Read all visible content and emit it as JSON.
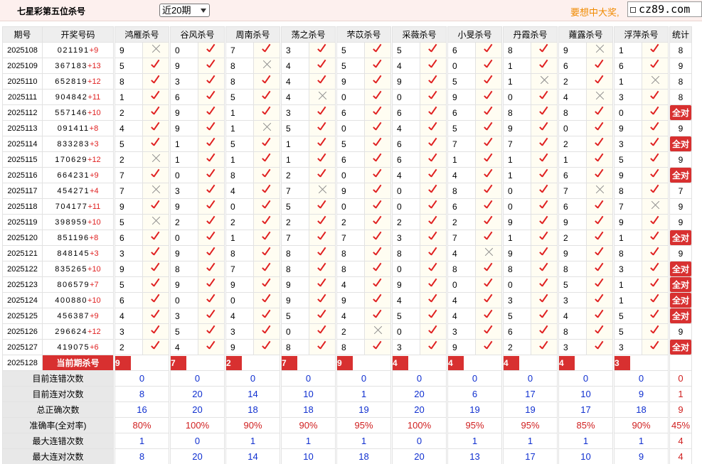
{
  "header": {
    "title": "七星彩第五位杀号",
    "period_select": "近20期",
    "promo": "要想中大奖,",
    "site": "cz89.com"
  },
  "columns": {
    "issue": "期号",
    "numbers": "开奖号码",
    "experts": [
      "鸿雁杀号",
      "谷风杀号",
      "周南杀号",
      "荡之杀号",
      "芣苡杀号",
      "采薇杀号",
      "小旻杀号",
      "丹霞杀号",
      "蕹露杀号",
      "浮萍杀号"
    ],
    "stat": "统计"
  },
  "draws": [
    {
      "issue": "2025108",
      "digits": "021191",
      "add": "+9",
      "kills": [
        [
          9,
          false
        ],
        [
          0,
          true
        ],
        [
          7,
          true
        ],
        [
          3,
          true
        ],
        [
          5,
          true
        ],
        [
          5,
          true
        ],
        [
          6,
          true
        ],
        [
          8,
          true
        ],
        [
          9,
          false
        ],
        [
          1,
          true
        ]
      ],
      "stat": "8"
    },
    {
      "issue": "2025109",
      "digits": "367183",
      "add": "+13",
      "kills": [
        [
          5,
          true
        ],
        [
          9,
          true
        ],
        [
          8,
          false
        ],
        [
          4,
          true
        ],
        [
          5,
          true
        ],
        [
          4,
          true
        ],
        [
          0,
          true
        ],
        [
          1,
          true
        ],
        [
          6,
          true
        ],
        [
          6,
          true
        ]
      ],
      "stat": "9"
    },
    {
      "issue": "2025110",
      "digits": "652819",
      "add": "+12",
      "kills": [
        [
          8,
          true
        ],
        [
          3,
          true
        ],
        [
          8,
          true
        ],
        [
          4,
          true
        ],
        [
          9,
          true
        ],
        [
          9,
          true
        ],
        [
          5,
          true
        ],
        [
          1,
          false
        ],
        [
          2,
          true
        ],
        [
          1,
          false
        ]
      ],
      "stat": "8"
    },
    {
      "issue": "2025111",
      "digits": "904842",
      "add": "+11",
      "kills": [
        [
          1,
          true
        ],
        [
          6,
          true
        ],
        [
          5,
          true
        ],
        [
          4,
          false
        ],
        [
          0,
          true
        ],
        [
          0,
          true
        ],
        [
          9,
          true
        ],
        [
          0,
          true
        ],
        [
          4,
          false
        ],
        [
          3,
          true
        ]
      ],
      "stat": "8"
    },
    {
      "issue": "2025112",
      "digits": "557146",
      "add": "+10",
      "kills": [
        [
          2,
          true
        ],
        [
          9,
          true
        ],
        [
          1,
          true
        ],
        [
          3,
          true
        ],
        [
          6,
          true
        ],
        [
          6,
          true
        ],
        [
          6,
          true
        ],
        [
          8,
          true
        ],
        [
          8,
          true
        ],
        [
          0,
          true
        ]
      ],
      "stat": "全对"
    },
    {
      "issue": "2025113",
      "digits": "091411",
      "add": "+8",
      "kills": [
        [
          4,
          true
        ],
        [
          9,
          true
        ],
        [
          1,
          false
        ],
        [
          5,
          true
        ],
        [
          0,
          true
        ],
        [
          4,
          true
        ],
        [
          5,
          true
        ],
        [
          9,
          true
        ],
        [
          0,
          true
        ],
        [
          9,
          true
        ]
      ],
      "stat": "9"
    },
    {
      "issue": "2025114",
      "digits": "833283",
      "add": "+3",
      "kills": [
        [
          5,
          true
        ],
        [
          1,
          true
        ],
        [
          5,
          true
        ],
        [
          1,
          true
        ],
        [
          5,
          true
        ],
        [
          6,
          true
        ],
        [
          7,
          true
        ],
        [
          7,
          true
        ],
        [
          2,
          true
        ],
        [
          3,
          true
        ]
      ],
      "stat": "全对"
    },
    {
      "issue": "2025115",
      "digits": "170629",
      "add": "+12",
      "kills": [
        [
          2,
          false
        ],
        [
          1,
          true
        ],
        [
          1,
          true
        ],
        [
          1,
          true
        ],
        [
          6,
          true
        ],
        [
          6,
          true
        ],
        [
          1,
          true
        ],
        [
          1,
          true
        ],
        [
          1,
          true
        ],
        [
          5,
          true
        ]
      ],
      "stat": "9"
    },
    {
      "issue": "2025116",
      "digits": "664231",
      "add": "+9",
      "kills": [
        [
          7,
          true
        ],
        [
          0,
          true
        ],
        [
          8,
          true
        ],
        [
          2,
          true
        ],
        [
          0,
          true
        ],
        [
          4,
          true
        ],
        [
          4,
          true
        ],
        [
          1,
          true
        ],
        [
          6,
          true
        ],
        [
          9,
          true
        ]
      ],
      "stat": "全对"
    },
    {
      "issue": "2025117",
      "digits": "454271",
      "add": "+4",
      "kills": [
        [
          7,
          false
        ],
        [
          3,
          true
        ],
        [
          4,
          true
        ],
        [
          7,
          false
        ],
        [
          9,
          true
        ],
        [
          0,
          true
        ],
        [
          8,
          true
        ],
        [
          0,
          true
        ],
        [
          7,
          false
        ],
        [
          8,
          true
        ]
      ],
      "stat": "7"
    },
    {
      "issue": "2025118",
      "digits": "704177",
      "add": "+11",
      "kills": [
        [
          9,
          true
        ],
        [
          9,
          true
        ],
        [
          0,
          true
        ],
        [
          5,
          true
        ],
        [
          0,
          true
        ],
        [
          0,
          true
        ],
        [
          6,
          true
        ],
        [
          0,
          true
        ],
        [
          6,
          true
        ],
        [
          7,
          false
        ]
      ],
      "stat": "9"
    },
    {
      "issue": "2025119",
      "digits": "398959",
      "add": "+10",
      "kills": [
        [
          5,
          false
        ],
        [
          2,
          true
        ],
        [
          2,
          true
        ],
        [
          2,
          true
        ],
        [
          2,
          true
        ],
        [
          2,
          true
        ],
        [
          2,
          true
        ],
        [
          9,
          true
        ],
        [
          9,
          true
        ],
        [
          9,
          true
        ]
      ],
      "stat": "9"
    },
    {
      "issue": "2025120",
      "digits": "851196",
      "add": "+8",
      "kills": [
        [
          6,
          true
        ],
        [
          0,
          true
        ],
        [
          1,
          true
        ],
        [
          7,
          true
        ],
        [
          7,
          true
        ],
        [
          3,
          true
        ],
        [
          7,
          true
        ],
        [
          1,
          true
        ],
        [
          2,
          true
        ],
        [
          1,
          true
        ]
      ],
      "stat": "全对"
    },
    {
      "issue": "2025121",
      "digits": "848145",
      "add": "+3",
      "kills": [
        [
          3,
          true
        ],
        [
          9,
          true
        ],
        [
          8,
          true
        ],
        [
          8,
          true
        ],
        [
          8,
          true
        ],
        [
          8,
          true
        ],
        [
          4,
          false
        ],
        [
          9,
          true
        ],
        [
          9,
          true
        ],
        [
          8,
          true
        ]
      ],
      "stat": "9"
    },
    {
      "issue": "2025122",
      "digits": "835265",
      "add": "+10",
      "kills": [
        [
          9,
          true
        ],
        [
          8,
          true
        ],
        [
          7,
          true
        ],
        [
          8,
          true
        ],
        [
          8,
          true
        ],
        [
          0,
          true
        ],
        [
          8,
          true
        ],
        [
          8,
          true
        ],
        [
          8,
          true
        ],
        [
          3,
          true
        ]
      ],
      "stat": "全对"
    },
    {
      "issue": "2025123",
      "digits": "806579",
      "add": "+7",
      "kills": [
        [
          5,
          true
        ],
        [
          9,
          true
        ],
        [
          9,
          true
        ],
        [
          9,
          true
        ],
        [
          4,
          true
        ],
        [
          9,
          true
        ],
        [
          0,
          true
        ],
        [
          0,
          true
        ],
        [
          5,
          true
        ],
        [
          1,
          true
        ]
      ],
      "stat": "全对"
    },
    {
      "issue": "2025124",
      "digits": "400880",
      "add": "+10",
      "kills": [
        [
          6,
          true
        ],
        [
          0,
          true
        ],
        [
          0,
          true
        ],
        [
          9,
          true
        ],
        [
          9,
          true
        ],
        [
          4,
          true
        ],
        [
          4,
          true
        ],
        [
          3,
          true
        ],
        [
          3,
          true
        ],
        [
          1,
          true
        ]
      ],
      "stat": "全对"
    },
    {
      "issue": "2025125",
      "digits": "456387",
      "add": "+9",
      "kills": [
        [
          4,
          true
        ],
        [
          3,
          true
        ],
        [
          4,
          true
        ],
        [
          5,
          true
        ],
        [
          4,
          true
        ],
        [
          5,
          true
        ],
        [
          4,
          true
        ],
        [
          5,
          true
        ],
        [
          4,
          true
        ],
        [
          5,
          true
        ]
      ],
      "stat": "全对"
    },
    {
      "issue": "2025126",
      "digits": "296624",
      "add": "+12",
      "kills": [
        [
          3,
          true
        ],
        [
          5,
          true
        ],
        [
          3,
          true
        ],
        [
          0,
          true
        ],
        [
          2,
          false
        ],
        [
          0,
          true
        ],
        [
          3,
          true
        ],
        [
          6,
          true
        ],
        [
          8,
          true
        ],
        [
          5,
          true
        ]
      ],
      "stat": "9"
    },
    {
      "issue": "2025127",
      "digits": "419075",
      "add": "+6",
      "kills": [
        [
          2,
          true
        ],
        [
          4,
          true
        ],
        [
          9,
          true
        ],
        [
          8,
          true
        ],
        [
          8,
          true
        ],
        [
          3,
          true
        ],
        [
          9,
          true
        ],
        [
          2,
          true
        ],
        [
          3,
          true
        ],
        [
          3,
          true
        ]
      ],
      "stat": "全对"
    }
  ],
  "current": {
    "issue": "2025128",
    "label": "当前期杀号",
    "kills": [
      "9",
      "7",
      "2",
      "7",
      "9",
      "4",
      "4",
      "4",
      "4",
      "3"
    ]
  },
  "stats": [
    {
      "label": "目前连错次数",
      "values": [
        "0",
        "0",
        "0",
        "0",
        "0",
        "0",
        "0",
        "0",
        "0",
        "0"
      ],
      "total": "0",
      "red": false
    },
    {
      "label": "目前连对次数",
      "values": [
        "8",
        "20",
        "14",
        "10",
        "1",
        "20",
        "6",
        "17",
        "10",
        "9"
      ],
      "total": "1",
      "red": false
    },
    {
      "label": "总正确次数",
      "values": [
        "16",
        "20",
        "18",
        "18",
        "19",
        "20",
        "19",
        "19",
        "17",
        "18"
      ],
      "total": "9",
      "red": false
    },
    {
      "label": "准确率(全对率)",
      "values": [
        "80%",
        "100%",
        "90%",
        "90%",
        "95%",
        "100%",
        "95%",
        "95%",
        "85%",
        "90%"
      ],
      "total": "45%",
      "red": true
    },
    {
      "label": "最大连错次数",
      "values": [
        "1",
        "0",
        "1",
        "1",
        "1",
        "0",
        "1",
        "1",
        "1",
        "1"
      ],
      "total": "4",
      "red": false
    },
    {
      "label": "最大连对次数",
      "values": [
        "8",
        "20",
        "14",
        "10",
        "18",
        "20",
        "13",
        "17",
        "10",
        "9"
      ],
      "total": "4",
      "red": false
    }
  ]
}
